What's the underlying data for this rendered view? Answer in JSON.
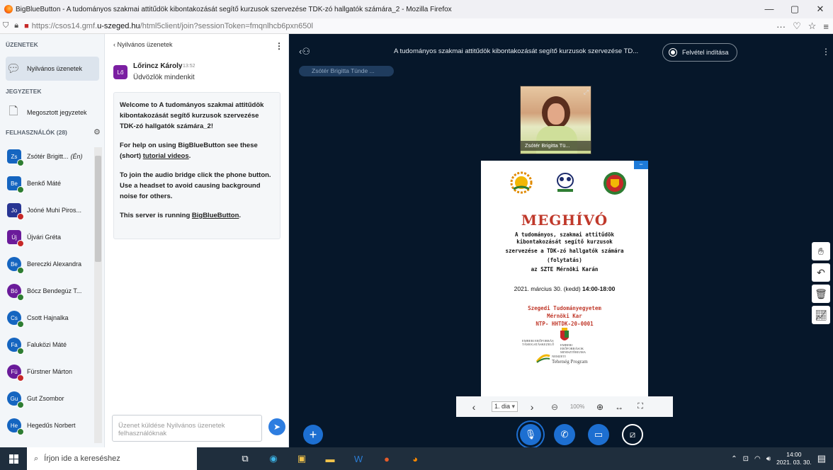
{
  "browser": {
    "window_title": "BigBlueButton - A tudományos szakmai attitűdök kibontakozását segítő kurzusok szervezése TDK-zó hallgatók számára_2 - Mozilla Firefox",
    "url_prefix": "https://csos14.gmf.",
    "url_domain": "u-szeged.hu",
    "url_path": "/html5client/join?sessionToken=fmqnlhcb6pxn650l",
    "win_min": "—",
    "win_max": "▢",
    "win_close": "✕",
    "more": "···",
    "pocket": "♡",
    "star": "☆",
    "menu": "≡"
  },
  "sidebar": {
    "messages_header": "ÜZENETEK",
    "public_chat": "Nyilvános üzenetek",
    "notes_header": "JEGYZETEK",
    "shared_notes": "Megosztott jegyzetek",
    "users_header": "FELHASZNÁLÓK (28)",
    "users": [
      {
        "initials": "Zs",
        "name": "Zsótér Brigitt...",
        "suffix": "(Én)",
        "color": "#1565c0",
        "mic": "#2e7d32"
      },
      {
        "initials": "Be",
        "name": "Benkő Máté",
        "color": "#1565c0",
        "mic": "#2e7d32"
      },
      {
        "initials": "Jo",
        "name": "Joóné Muhi Piros...",
        "color": "#283593",
        "mic": "#c62828"
      },
      {
        "initials": "Új",
        "name": "Újvári Gréta",
        "color": "#6a1b9a",
        "mic": "#c62828"
      },
      {
        "initials": "Be",
        "name": "Bereczki Alexandra",
        "color": "#1565c0",
        "mic": "#2e7d32"
      },
      {
        "initials": "Bó",
        "name": "Bócz Bendegúz T...",
        "color": "#6a1b9a",
        "mic": "#2e7d32"
      },
      {
        "initials": "Cs",
        "name": "Csott Hajnalka",
        "color": "#1565c0",
        "mic": "#2e7d32"
      },
      {
        "initials": "Fa",
        "name": "Faluközi Máté",
        "color": "#1565c0",
        "mic": "#2e7d32"
      },
      {
        "initials": "Fü",
        "name": "Fürstner Márton",
        "color": "#6a1b9a",
        "mic": "#c62828"
      },
      {
        "initials": "Gu",
        "name": "Gut Zsombor",
        "color": "#1565c0",
        "mic": "#2e7d32"
      },
      {
        "initials": "He",
        "name": "Hegedűs Norbert",
        "color": "#1565c0",
        "mic": "#2e7d32"
      }
    ]
  },
  "chat": {
    "header": "Nyilvános üzenetek",
    "back": "‹",
    "options": "⋮",
    "sender_initials": "Lő",
    "sender": "Lőrincz Károly",
    "time": "13:52",
    "message": "Üdvözlök mindenkit",
    "welcome_prefix": "Welcome to ",
    "welcome_title": "A tudományos szakmai attitűdök kibontakozását segítő kurzusok szervezése TDK-zó hallgatók számára_2",
    "welcome_suffix": "!",
    "help_prefix": "For help on using BigBlueButton see these (short) ",
    "help_link": "tutorial videos",
    "help_suffix": ".",
    "audio_text": "To join the audio bridge click the phone button. Use a headset to avoid causing background noise for others.",
    "server_prefix": "This server is running ",
    "server_link": "BigBlueButton",
    "server_suffix": ".",
    "input_placeholder": "Üzenet küldése Nyilvános üzenetek felhasználóknak"
  },
  "meeting": {
    "title": "A tudományos szakmai attitűdök kibontakozását segítő kurzusok szervezése TD...",
    "record_label": "Felvétel indítása",
    "talking": "Zsótér Brigitta Tünde ...",
    "webcam_name": "Zsótér Brigitta Tü..."
  },
  "slide": {
    "heading": "MEGHÍVÓ",
    "lines": [
      "A tudományos, szakmai attitűdök",
      "kibontakozását segítő kurzusok",
      "szervezése a TDK-zó hallgatók számára",
      "(folytatás)",
      "az SZTE Mérnöki Karán"
    ],
    "date": "2021. március 30. (kedd) ",
    "time": "14:00-18:00",
    "org": [
      "Szegedi Tudományegyetem",
      "Mérnöki Kar",
      "NTP- HHTDK-20-0001"
    ],
    "sponsor1": "EMBERI ERŐFORRÁS TÁMOGATÁSKEZELŐ",
    "sponsor2": "EMBERI ERŐFORRÁSOK MINISZTÉRIUMA",
    "sponsor3a": "NEMZETI",
    "sponsor3b": "Tehetség Program",
    "minimize": "−"
  },
  "slide_controls": {
    "prev": "‹",
    "page": "1. dia",
    "next": "›",
    "zoom_out": "⊖",
    "zoom": "100%",
    "zoom_in": "⊕",
    "fit_width": "↔",
    "fullscreen": "⛶"
  },
  "taskbar": {
    "search_placeholder": "Írjon ide a kereséshez",
    "time": "14:00",
    "date": "2021. 03. 30."
  }
}
